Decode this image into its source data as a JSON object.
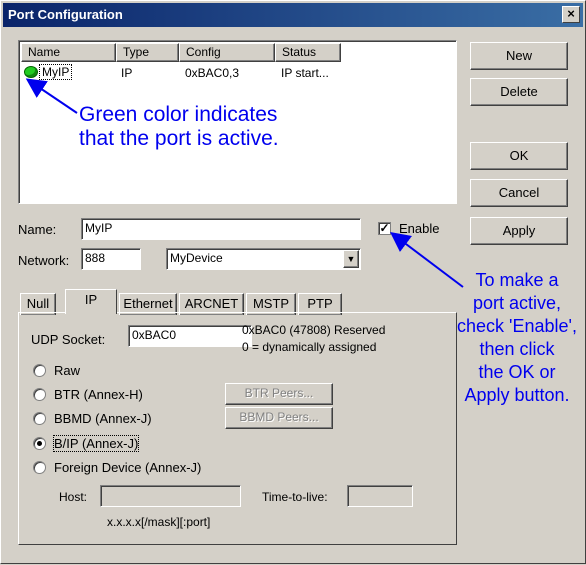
{
  "window": {
    "title": "Port Configuration",
    "close_glyph": "×"
  },
  "list": {
    "headers": [
      "Name",
      "Type",
      "Config",
      "Status"
    ],
    "rows": [
      {
        "name": "MyIP",
        "type": "IP",
        "config": "0xBAC0,3",
        "status": "IP start..."
      }
    ],
    "active_color": "#22cc22"
  },
  "buttons": {
    "new": "New",
    "delete": "Delete",
    "ok": "OK",
    "cancel": "Cancel",
    "apply": "Apply"
  },
  "form": {
    "name_label": "Name:",
    "name_value": "MyIP",
    "enable_label": "Enable",
    "enable_checked": true,
    "network_label": "Network:",
    "network_value": "888",
    "device_value": "MyDevice"
  },
  "tabs": [
    "Null",
    "IP",
    "Ethernet",
    "ARCNET",
    "MSTP",
    "PTP"
  ],
  "ip_tab": {
    "udp_label": "UDP Socket:",
    "udp_value": "0xBAC0",
    "udp_note1": "0xBAC0 (47808) Reserved",
    "udp_note2": "0 = dynamically assigned",
    "options": [
      "Raw",
      "BTR (Annex-H)",
      "BBMD (Annex-J)",
      "B/IP (Annex-J)",
      "Foreign Device (Annex-J)"
    ],
    "selected_option": "B/IP (Annex-J)",
    "btr_peers": "BTR Peers...",
    "bbmd_peers": "BBMD Peers...",
    "host_label": "Host:",
    "ttl_label": "Time-to-live:",
    "host_hint": "x.x.x.x[/mask][:port]"
  },
  "annotations": {
    "green_line1": "Green color indicates",
    "green_line2": "that the port is active.",
    "enable_lines": [
      "To make a",
      "port active,",
      "check 'Enable',",
      "then click",
      "the OK or",
      "Apply button."
    ],
    "color": "#0000ee"
  }
}
